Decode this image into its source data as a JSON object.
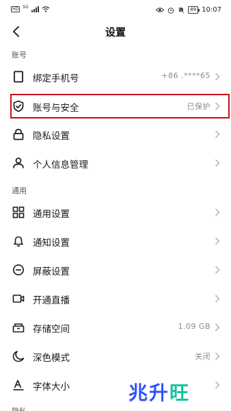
{
  "status_bar": {
    "sim_badge": "HD",
    "network": "5G",
    "battery": "89",
    "time": "10:07"
  },
  "header": {
    "title": "设置"
  },
  "sections": {
    "account": {
      "label": "账号"
    },
    "general": {
      "label": "通用"
    },
    "cut_label": "隐私"
  },
  "account_items": [
    {
      "label": "绑定手机号",
      "value": "+86 .****65",
      "icon": "phone-icon"
    },
    {
      "label": "账号与安全",
      "value": "已保护",
      "icon": "shield-check-icon"
    },
    {
      "label": "隐私设置",
      "value": "",
      "icon": "lock-icon"
    },
    {
      "label": "个人信息管理",
      "value": "",
      "icon": "person-icon"
    }
  ],
  "general_items": [
    {
      "label": "通用设置",
      "value": "",
      "icon": "grid-icon"
    },
    {
      "label": "通知设置",
      "value": "",
      "icon": "bell-icon"
    },
    {
      "label": "屏蔽设置",
      "value": "",
      "icon": "block-icon"
    },
    {
      "label": "开通直播",
      "value": "",
      "icon": "video-camera-icon"
    },
    {
      "label": "存储空间",
      "value": "1.09 GB",
      "icon": "storage-icon"
    },
    {
      "label": "深色模式",
      "value": "关闭",
      "icon": "moon-icon"
    },
    {
      "label": "字体大小",
      "value": "",
      "icon": "font-size-icon"
    }
  ],
  "watermark": {
    "text": "兆升旺"
  },
  "colors": {
    "highlight": "#c40f1c",
    "watermark_blue": "#2f52ff",
    "watermark_green": "#15c4a0"
  }
}
